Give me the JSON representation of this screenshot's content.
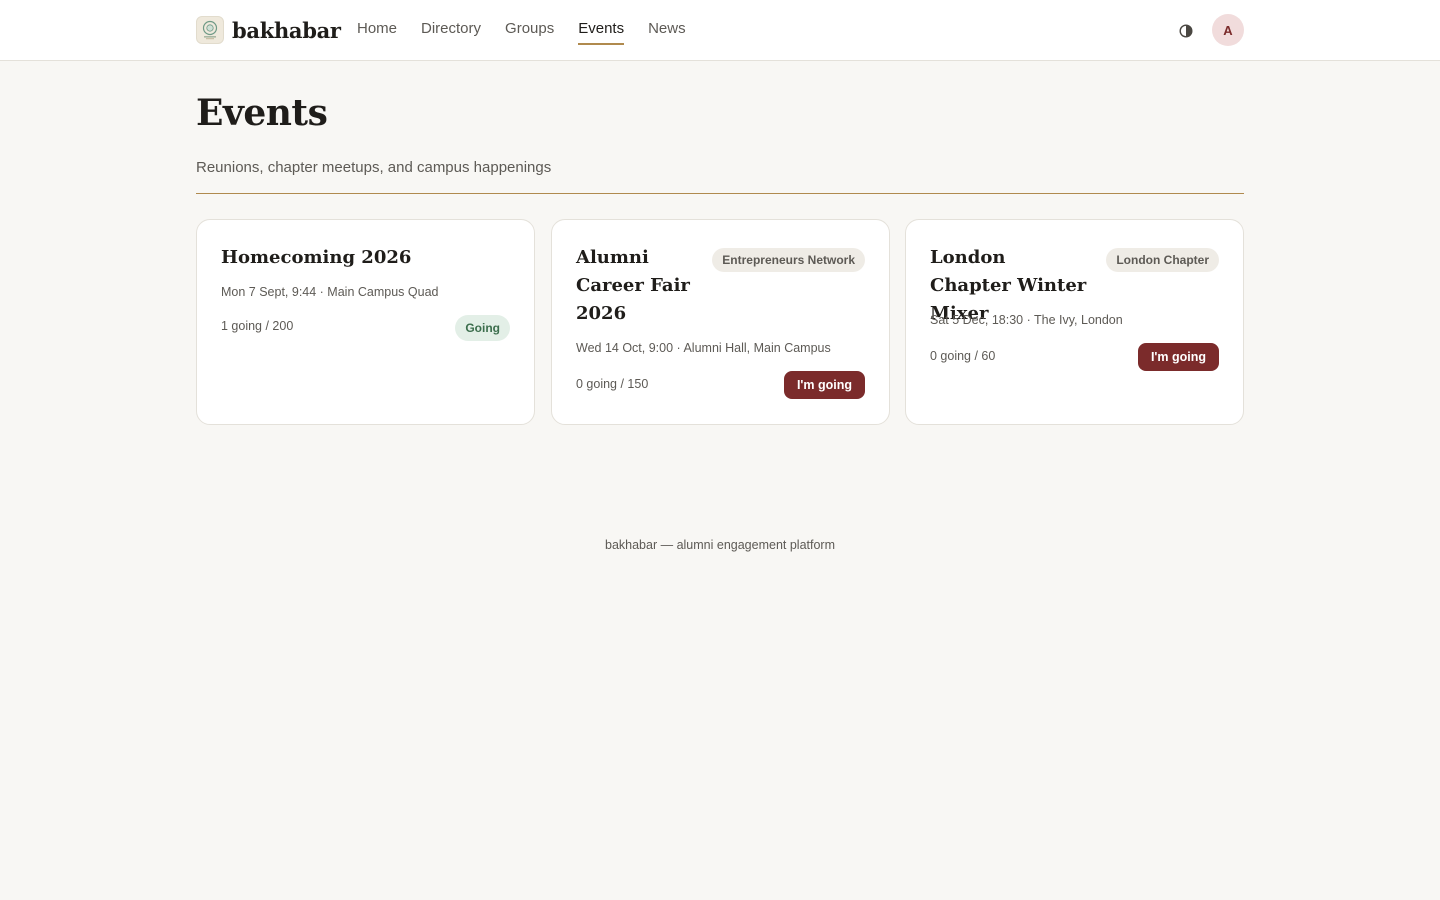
{
  "app": {
    "brand_name": "bakhabar",
    "logo_icon": "university-crest-icon"
  },
  "nav": {
    "items": [
      {
        "label": "Home",
        "active": false
      },
      {
        "label": "Directory",
        "active": false
      },
      {
        "label": "Groups",
        "active": false
      },
      {
        "label": "Events",
        "active": true
      },
      {
        "label": "News",
        "active": false
      }
    ]
  },
  "header": {
    "theme_toggle_icon": "contrast-icon",
    "theme_toggle_glyph": "◑",
    "avatar_initial": "A"
  },
  "page": {
    "title": "Events",
    "subtitle": "Reunions, chapter meetups, and campus happenings"
  },
  "events": [
    {
      "title": "Homecoming 2026",
      "group": "",
      "when_where": "Mon 7 Sept, 9:44 · Main Campus Quad",
      "count": "1 going / 200",
      "status_label": "Going",
      "status": "going"
    },
    {
      "title": "Alumni Career Fair 2026",
      "group": "Entrepreneurs Network",
      "when_where": "Wed 14 Oct, 9:00 · Alumni Hall, Main Campus",
      "count": "0 going / 150",
      "status_label": "I'm going",
      "status": "rsvp"
    },
    {
      "title": "London Chapter Winter Mixer",
      "group": "London Chapter",
      "when_where": "Sat 5 Dec, 18:30 · The Ivy, London",
      "count": "0 going / 60",
      "status_label": "I'm going",
      "status": "rsvp"
    }
  ],
  "footer": {
    "text": "bakhabar — alumni engagement platform"
  },
  "colors": {
    "accent": "#b08a4e",
    "primary_button": "#7b2b2b",
    "going_badge_bg": "#e3efe7",
    "going_badge_text": "#3c6e4d",
    "background": "#f8f7f4"
  }
}
